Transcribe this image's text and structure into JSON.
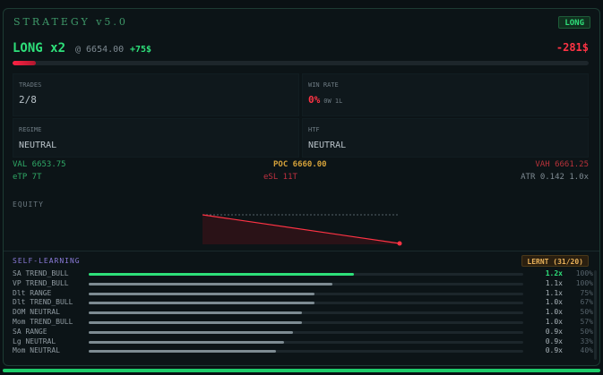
{
  "header": {
    "title": "STRATEGY v5.0",
    "badge": "LONG"
  },
  "position": {
    "label": "LONG x2",
    "price": "@ 6654.00",
    "gain": "+75$",
    "pnl": "-281$",
    "progress": 0.04
  },
  "stats": {
    "trades_label": "TRADES",
    "trades_value": "2/8",
    "winrate_label": "WIN RATE",
    "winrate_value": "0%",
    "winrate_sub": "0W 1L",
    "regime_label": "REGIME",
    "regime_value": "NEUTRAL",
    "htf_label": "HTF",
    "htf_value": "NEUTRAL"
  },
  "levels": {
    "val": "VAL 6653.75",
    "poc": "POC 6660.00",
    "vah": "VAH 6661.25",
    "etp": "eTP 7T",
    "esl": "eSL 11T",
    "atr": "ATR 0.142 1.0x"
  },
  "equity": {
    "label": "EQUITY",
    "values": [
      0,
      -1
    ]
  },
  "self_learning": {
    "title": "SELF-LEARNING",
    "badge": "LERNT (31/20)",
    "rows": [
      {
        "name": "SA TREND_BULL",
        "fill": 0.61,
        "mult": "1.2x",
        "pct": "100%",
        "hi": true
      },
      {
        "name": "VP TREND_BULL",
        "fill": 0.56,
        "mult": "1.1x",
        "pct": "100%",
        "hi": false
      },
      {
        "name": "Dlt RANGE",
        "fill": 0.52,
        "mult": "1.1x",
        "pct": "75%",
        "hi": false
      },
      {
        "name": "Dlt TREND_BULL",
        "fill": 0.52,
        "mult": "1.0x",
        "pct": "67%",
        "hi": false
      },
      {
        "name": "DOM NEUTRAL",
        "fill": 0.49,
        "mult": "1.0x",
        "pct": "50%",
        "hi": false
      },
      {
        "name": "Mom TREND_BULL",
        "fill": 0.49,
        "mult": "1.0x",
        "pct": "57%",
        "hi": false
      },
      {
        "name": "SA RANGE",
        "fill": 0.47,
        "mult": "0.9x",
        "pct": "50%",
        "hi": false
      },
      {
        "name": "Lg NEUTRAL",
        "fill": 0.45,
        "mult": "0.9x",
        "pct": "33%",
        "hi": false
      },
      {
        "name": "Mom NEUTRAL",
        "fill": 0.43,
        "mult": "0.9x",
        "pct": "40%",
        "hi": false
      }
    ]
  },
  "colors": {
    "green": "#2ee07a",
    "red": "#ff3344",
    "gold": "#d4a13a",
    "purple": "#8a7ad8"
  }
}
